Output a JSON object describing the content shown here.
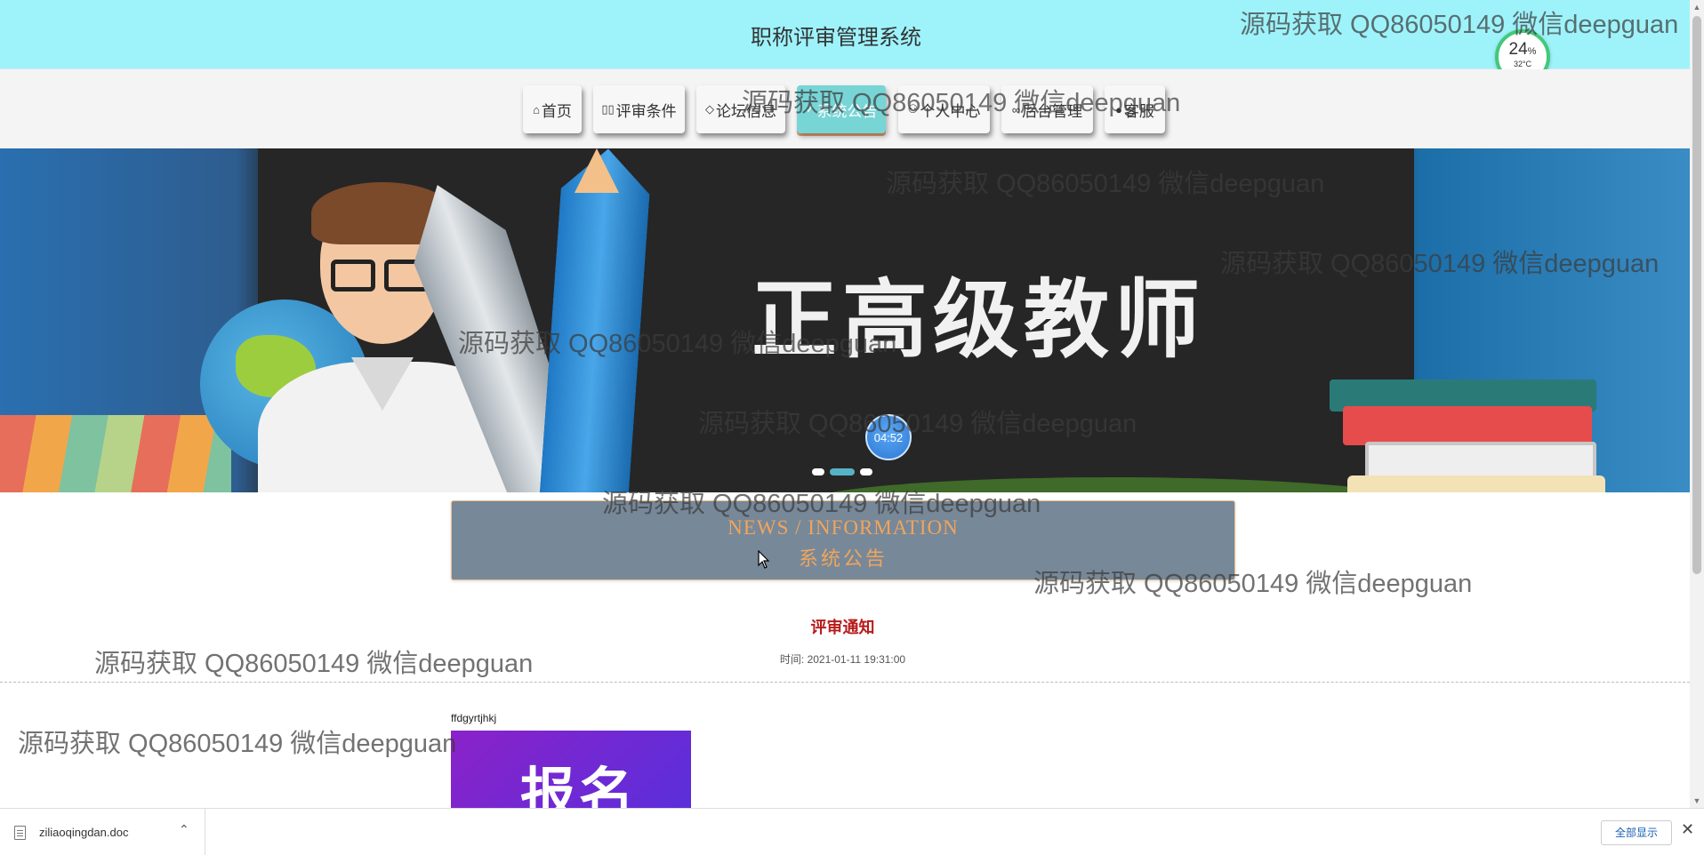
{
  "header": {
    "title": "职称评审管理系统"
  },
  "widget": {
    "percent": "24",
    "percent_unit": "%",
    "temperature": "32°C"
  },
  "nav": {
    "active_index": 3,
    "items": [
      {
        "icon": "home-icon",
        "glyph": "⌂",
        "label": "首页"
      },
      {
        "icon": "users-icon",
        "glyph": "▯▯",
        "label": "评审条件"
      },
      {
        "icon": "tag-icon",
        "glyph": "◇",
        "label": "论坛信息"
      },
      {
        "icon": "bell-icon",
        "glyph": "✓",
        "label": "系统公告"
      },
      {
        "icon": "user-icon",
        "glyph": "⚇",
        "label": "个人中心"
      },
      {
        "icon": "link-icon",
        "glyph": "∞",
        "label": "后台管理"
      },
      {
        "icon": "chat-icon",
        "glyph": "●",
        "label": "客服"
      }
    ]
  },
  "banner": {
    "headline": "正高级教师",
    "timer": "04:52",
    "slide_count": 3,
    "active_slide": 1
  },
  "news": {
    "title_en": "NEWS / INFORMATION",
    "title_cn": "系统公告"
  },
  "article": {
    "title": "评审通知",
    "time_label": "时间:",
    "time_value": "2021-01-11 19:31:00",
    "body": "ffdgyrtjhkj",
    "image_text": "报名"
  },
  "watermark": {
    "text": "源码获取 QQ86050149 微信deepguan"
  },
  "downloads": {
    "file_name": "ziliaoqingdan.doc",
    "show_all_label": "全部显示"
  },
  "colors": {
    "header_bg": "#9ef3fb",
    "nav_active": "#78d5d6",
    "news_bg": "#778899",
    "news_text": "#f1a55b",
    "article_title": "#b81b1b"
  }
}
